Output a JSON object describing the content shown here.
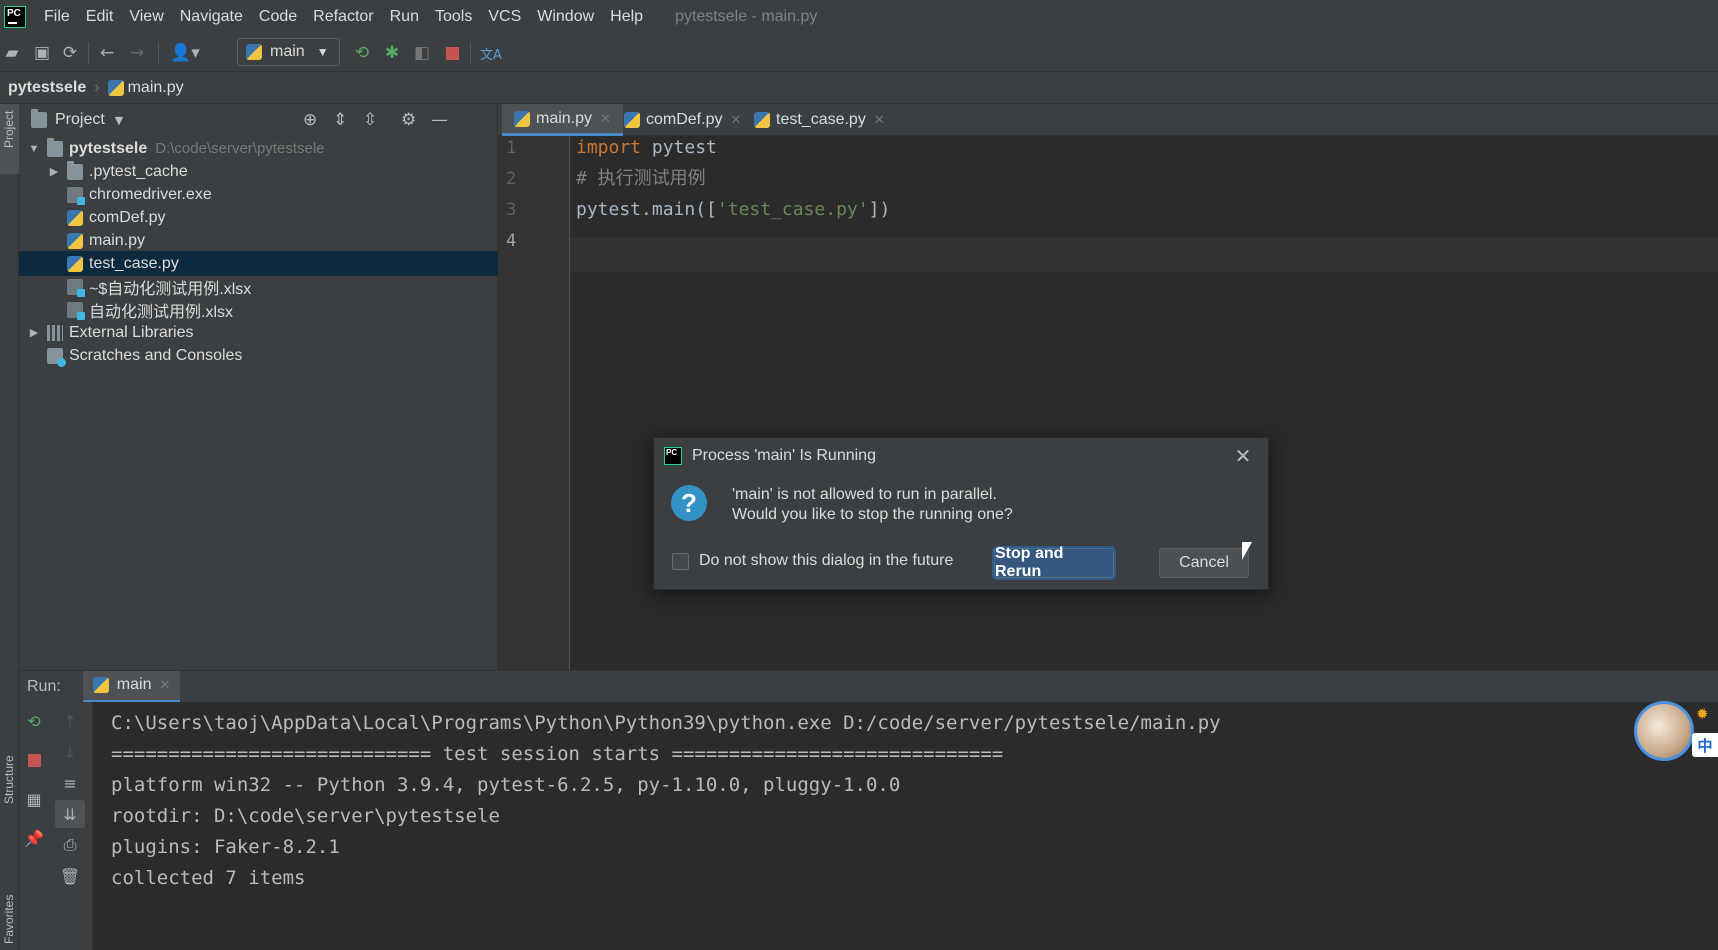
{
  "menubar": {
    "logo_text": "PC",
    "items": [
      "File",
      "Edit",
      "View",
      "Navigate",
      "Code",
      "Refactor",
      "Run",
      "Tools",
      "VCS",
      "Window",
      "Help"
    ],
    "window_title": "pytestsele - main.py"
  },
  "toolbar": {
    "run_config": "main",
    "translate_glyph": "文A"
  },
  "breadcrumb": {
    "root": "pytestsele",
    "file": "main.py"
  },
  "left_strip": {
    "project": "Project",
    "structure": "Structure",
    "favorites": "Favorites"
  },
  "project": {
    "header": "Project",
    "root_name": "pytestsele",
    "root_path": "D:\\code\\server\\pytestsele",
    "items": [
      {
        "label": ".pytest_cache"
      },
      {
        "label": "chromedriver.exe"
      },
      {
        "label": "comDef.py"
      },
      {
        "label": "main.py"
      },
      {
        "label": "test_case.py"
      },
      {
        "label": "~$自动化测试用例.xlsx"
      },
      {
        "label": "自动化测试用例.xlsx"
      }
    ],
    "external_libraries": "External Libraries",
    "scratches": "Scratches and Consoles"
  },
  "editor": {
    "tabs": [
      {
        "label": "main.py"
      },
      {
        "label": "comDef.py"
      },
      {
        "label": "test_case.py"
      }
    ],
    "line_numbers": [
      "1",
      "2",
      "3",
      "4"
    ],
    "code": {
      "l1_kw": "import",
      "l1_rest": " pytest",
      "l2_comment": "# 执行测试用例",
      "l3_pre": "pytest.main([",
      "l3_str": "'test_case.py'",
      "l3_post": "])"
    }
  },
  "run": {
    "label": "Run:",
    "tab": "main",
    "console": [
      "C:\\Users\\taoj\\AppData\\Local\\Programs\\Python\\Python39\\python.exe D:/code/server/pytestsele/main.py",
      "============================ test session starts =============================",
      "platform win32 -- Python 3.9.4, pytest-6.2.5, py-1.10.0, pluggy-1.0.0",
      "rootdir: D:\\code\\server\\pytestsele",
      "plugins: Faker-8.2.1",
      "collected 7 items"
    ]
  },
  "dialog": {
    "title": "Process 'main' Is Running",
    "message_line1": "'main' is not allowed to run in parallel.",
    "message_line2": "Would you like to stop the running one?",
    "checkbox_label": "Do not show this dialog in the future",
    "primary_button": "Stop and Rerun",
    "cancel_button": "Cancel",
    "close_glyph": "✕"
  },
  "ime": {
    "badge": "中"
  }
}
